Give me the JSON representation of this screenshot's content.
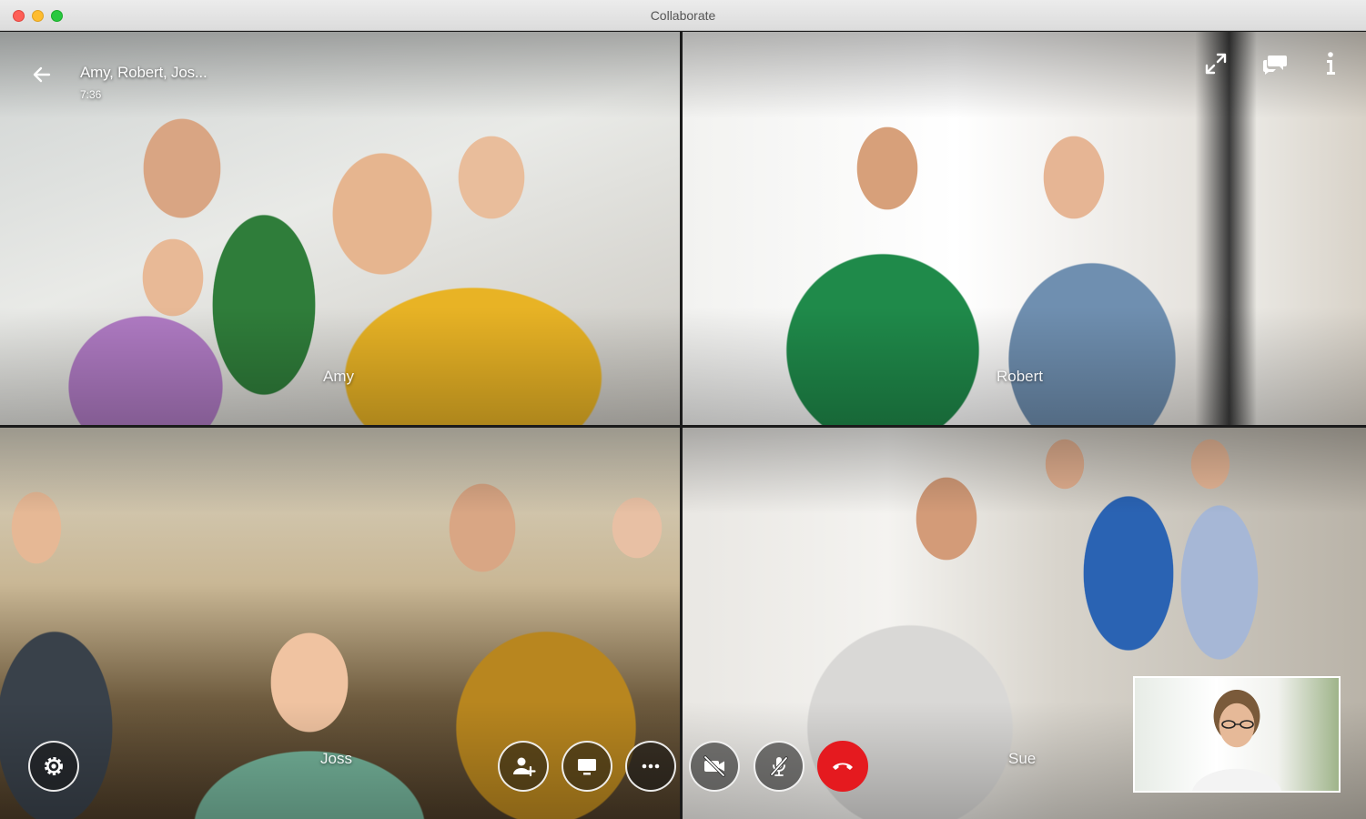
{
  "window": {
    "title": "Collaborate"
  },
  "call": {
    "title": "Amy, Robert, Jos...",
    "time": "7:36"
  },
  "participants": [
    {
      "name": "Amy"
    },
    {
      "name": "Robert"
    },
    {
      "name": "Joss"
    },
    {
      "name": "Sue"
    }
  ],
  "top_controls": [
    {
      "icon": "fullscreen-icon"
    },
    {
      "icon": "chat-icon"
    },
    {
      "icon": "info-icon"
    }
  ],
  "bottom_controls": [
    {
      "icon": "settings-icon"
    },
    {
      "icon": "add-participant-icon"
    },
    {
      "icon": "share-screen-icon"
    },
    {
      "icon": "more-icon"
    },
    {
      "icon": "video-off-icon"
    },
    {
      "icon": "mic-off-icon"
    },
    {
      "icon": "end-call-icon"
    }
  ],
  "colors": {
    "end_call": "#e51a1f",
    "title_bar": "#e3e3e3"
  }
}
